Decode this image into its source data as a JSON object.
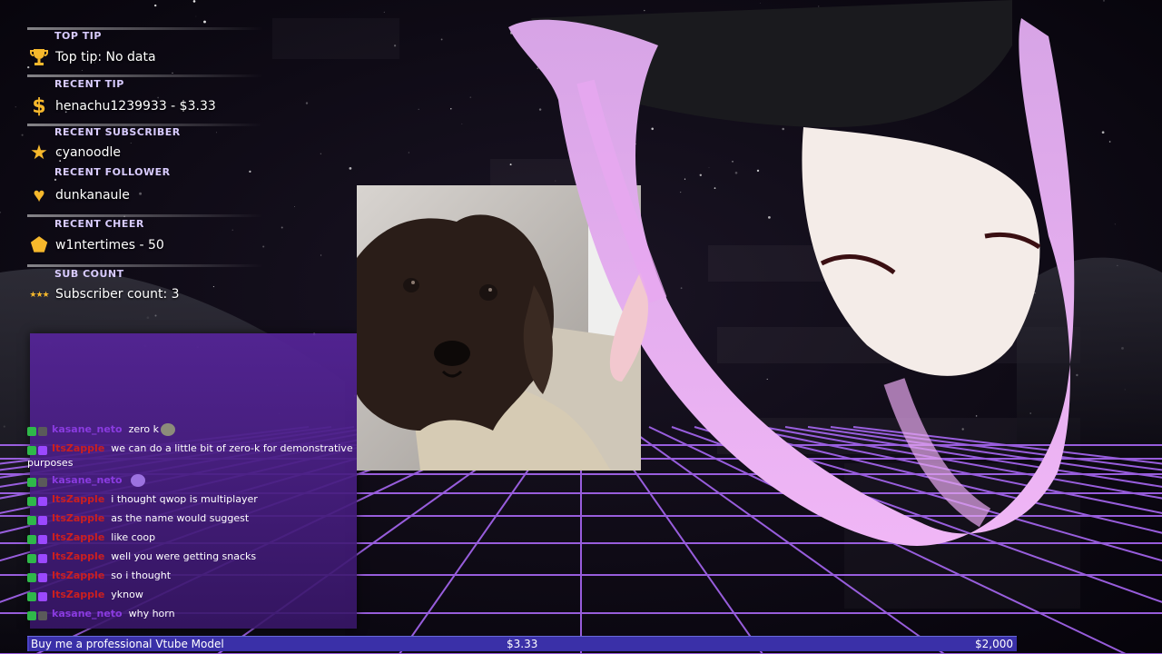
{
  "colors": {
    "accent": "#8a3be0",
    "user_red": "#cc1f1f",
    "goal_bar": "#3a30a8",
    "label": "#d9ccff"
  },
  "widgets": {
    "top_tip": {
      "label": "TOP TIP",
      "value": "Top tip: No data",
      "icon": "trophy-icon"
    },
    "recent_tip": {
      "label": "RECENT TIP",
      "value": "henachu1239933 - $3.33",
      "icon": "dollar-icon"
    },
    "recent_subscriber": {
      "label": "RECENT SUBSCRIBER",
      "value": "cyanoodle",
      "icon": "star-icon"
    },
    "recent_follower": {
      "label": "RECENT FOLLOWER",
      "value": "dunkanaule",
      "icon": "heart-icon"
    },
    "recent_cheer": {
      "label": "RECENT CHEER",
      "value": "w1ntertimes - 50",
      "icon": "gem-icon"
    },
    "sub_count": {
      "label": "SUB COUNT",
      "value": "Subscriber count: 3",
      "icon": "stars-icon"
    }
  },
  "chat": {
    "messages": [
      {
        "user": "kasane_neto",
        "text": "zero k",
        "emote": true
      },
      {
        "user": "ItsZapple",
        "text": "we can do a little bit of zero-k for demonstrative purposes",
        "emote": false
      },
      {
        "user": "kasane_neto",
        "text": "",
        "emote": true
      },
      {
        "user": "ItsZapple",
        "text": "i thought qwop is multiplayer",
        "emote": false
      },
      {
        "user": "ItsZapple",
        "text": "as the name would suggest",
        "emote": false
      },
      {
        "user": "ItsZapple",
        "text": "like coop",
        "emote": false
      },
      {
        "user": "ItsZapple",
        "text": "well you were getting snacks",
        "emote": false
      },
      {
        "user": "ItsZapple",
        "text": "so i thought",
        "emote": false
      },
      {
        "user": "ItsZapple",
        "text": "yknow",
        "emote": false
      },
      {
        "user": "kasane_neto",
        "text": "why horn",
        "emote": false
      }
    ]
  },
  "goal": {
    "title": "Buy me a professional Vtube Model",
    "current": "$3.33",
    "target": "$2,000",
    "progress_fraction": 0.0017
  }
}
